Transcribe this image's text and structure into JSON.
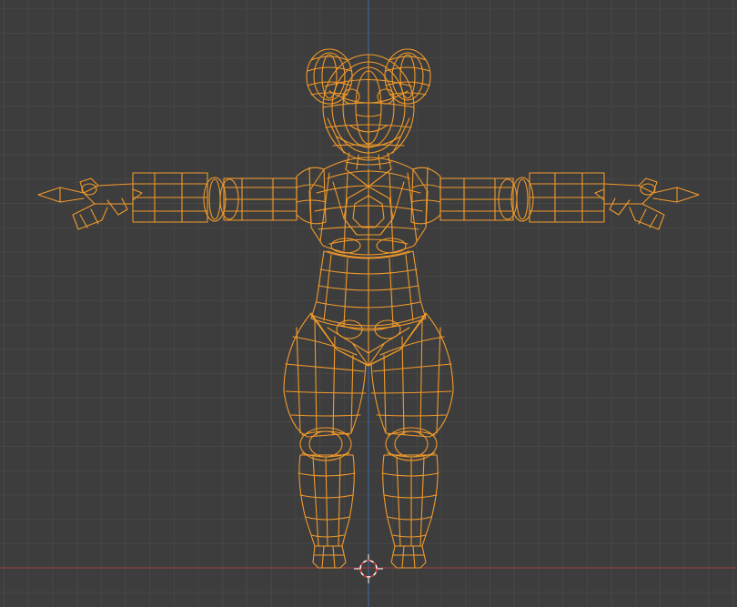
{
  "viewport": {
    "background_color": "#3d3d3d",
    "grid_minor_color": "#474747",
    "grid_major_color": "#505050",
    "x_axis_color": "#a43d45",
    "y_axis_color": "#3d6aa8",
    "wire_color": "#f29a2a",
    "wire_inner_color": "#c77a1f",
    "cursor_outer_color": "#ffffff",
    "cursor_inner_color": "#d83030"
  },
  "scene": {
    "view": "front-orthographic",
    "shading": "wireframe",
    "selected_object": "character-mesh",
    "pose": "t-pose"
  },
  "icons": {
    "cursor": "3d-cursor-icon"
  }
}
